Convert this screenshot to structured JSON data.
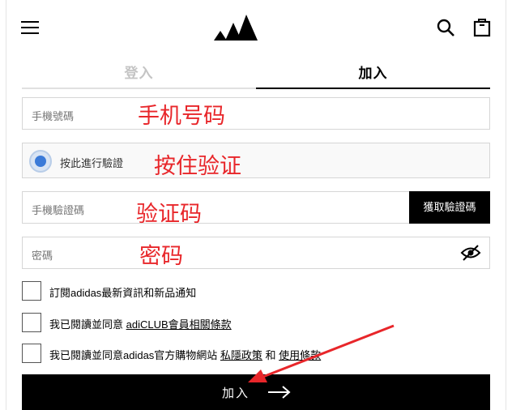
{
  "header": {
    "menu_icon": "hamburger-menu-icon",
    "logo_icon": "adidas-performance-logo",
    "search_icon": "search-icon",
    "bag_icon": "shopping-bag-icon"
  },
  "tabs": [
    {
      "label": "登入",
      "active": false
    },
    {
      "label": "加入",
      "active": true
    }
  ],
  "form": {
    "phone": {
      "placeholder": "手機號碼",
      "annotation": "手机号码"
    },
    "captcha": {
      "label": "按此進行驗證",
      "annotation": "按住验证"
    },
    "sms_code": {
      "placeholder": "手機驗證碼",
      "annotation": "验证码",
      "button_label": "獲取驗證碼"
    },
    "password": {
      "placeholder": "密碼",
      "annotation": "密码",
      "toggle_icon": "eye-slash-icon"
    }
  },
  "checkboxes": {
    "newsletter": {
      "text": "訂閱adidas最新資訊和新品通知"
    },
    "adiclub": {
      "prefix": "我已閱讀並同意 ",
      "link": "adiCLUB會員相關條款"
    },
    "terms": {
      "prefix": "我已閱讀並同意adidas官方購物網站 ",
      "privacy_link": "私隱政策",
      "joiner": " 和 ",
      "terms_link": "使用條款"
    }
  },
  "submit": {
    "label": "加入",
    "arrow_icon": "right-arrow-icon"
  },
  "colors": {
    "accent": "#000000",
    "annotation": "#e8262a",
    "captcha_radio": "#3a7ad8"
  }
}
